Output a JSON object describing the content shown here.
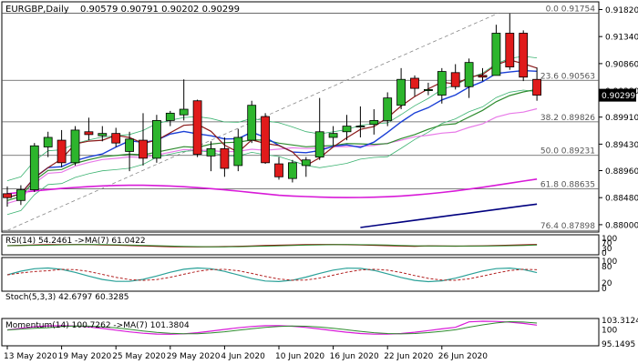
{
  "header": {
    "symbol": "EURGBP,Daily",
    "ohlc": "0.90579 0.90791 0.90202 0.90299"
  },
  "colors": {
    "bull_candle": "#2db52d",
    "bear_candle": "#e01b1b",
    "ma_fast": "#8b1a1a",
    "ma_blue": "#1a3fd6",
    "ma_green": "#2e8b2e",
    "ma_pink": "#e87ae8",
    "ma_magenta": "#d81ad8",
    "ma_navy": "#00007f",
    "bollinger": "#3cb371",
    "fib": "#555555",
    "trend": "#888888",
    "price_tag": "#000000"
  },
  "chart_data": [
    {
      "type": "candlestick",
      "title": "EURGBP,Daily",
      "price_axis_ticks": [
        "0.91820",
        "0.91340",
        "0.90860",
        "0.90380",
        "0.89910",
        "0.89430",
        "0.88960",
        "0.88480",
        "0.88000"
      ],
      "ylim": [
        0.8795,
        0.9186
      ],
      "last_price": "0.90299",
      "date_labels": [
        "13 May 2020",
        "19 May 2020",
        "25 May 2020",
        "29 May 2020",
        "4 Jun 2020",
        "10 Jun 2020",
        "16 Jun 2020",
        "22 Jun 2020",
        "26 Jun 2020"
      ],
      "date_label_index": [
        0,
        4,
        8,
        12,
        16,
        20,
        24,
        28,
        32
      ],
      "fibonacci": [
        {
          "label": "0.0 0.91754",
          "value": 0.91754
        },
        {
          "label": "23.6 0.90563",
          "value": 0.90563
        },
        {
          "label": "38.2 0.89826",
          "value": 0.89826
        },
        {
          "label": "50.0 0.89231",
          "value": 0.89231
        },
        {
          "label": "61.8 0.88635",
          "value": 0.88635
        },
        {
          "label": "76.4 0.87898",
          "value": 0.87898
        }
      ],
      "candles": [
        {
          "o": 0.8855,
          "h": 0.8868,
          "l": 0.8832,
          "c": 0.8848
        },
        {
          "o": 0.8843,
          "h": 0.887,
          "l": 0.8835,
          "c": 0.8862
        },
        {
          "o": 0.8862,
          "h": 0.8945,
          "l": 0.8858,
          "c": 0.894
        },
        {
          "o": 0.8938,
          "h": 0.8965,
          "l": 0.892,
          "c": 0.8955
        },
        {
          "o": 0.895,
          "h": 0.8968,
          "l": 0.8902,
          "c": 0.891
        },
        {
          "o": 0.891,
          "h": 0.8975,
          "l": 0.8905,
          "c": 0.8968
        },
        {
          "o": 0.8965,
          "h": 0.899,
          "l": 0.895,
          "c": 0.896
        },
        {
          "o": 0.8958,
          "h": 0.8975,
          "l": 0.8948,
          "c": 0.8962
        },
        {
          "o": 0.8962,
          "h": 0.8972,
          "l": 0.8938,
          "c": 0.8945
        },
        {
          "o": 0.893,
          "h": 0.8965,
          "l": 0.8895,
          "c": 0.8952
        },
        {
          "o": 0.895,
          "h": 0.8998,
          "l": 0.8905,
          "c": 0.8918
        },
        {
          "o": 0.8918,
          "h": 0.8995,
          "l": 0.891,
          "c": 0.8985
        },
        {
          "o": 0.8985,
          "h": 0.9002,
          "l": 0.8975,
          "c": 0.8998
        },
        {
          "o": 0.8995,
          "h": 0.9058,
          "l": 0.8985,
          "c": 0.9005
        },
        {
          "o": 0.902,
          "h": 0.9022,
          "l": 0.892,
          "c": 0.8925
        },
        {
          "o": 0.8922,
          "h": 0.8948,
          "l": 0.8895,
          "c": 0.8935
        },
        {
          "o": 0.8935,
          "h": 0.8955,
          "l": 0.8885,
          "c": 0.89
        },
        {
          "o": 0.8905,
          "h": 0.897,
          "l": 0.8895,
          "c": 0.8955
        },
        {
          "o": 0.895,
          "h": 0.902,
          "l": 0.8945,
          "c": 0.9012
        },
        {
          "o": 0.8992,
          "h": 0.8998,
          "l": 0.8908,
          "c": 0.891
        },
        {
          "o": 0.8908,
          "h": 0.892,
          "l": 0.888,
          "c": 0.8885
        },
        {
          "o": 0.8882,
          "h": 0.8915,
          "l": 0.8875,
          "c": 0.891
        },
        {
          "o": 0.8905,
          "h": 0.892,
          "l": 0.8885,
          "c": 0.8915
        },
        {
          "o": 0.892,
          "h": 0.9025,
          "l": 0.8915,
          "c": 0.8965
        },
        {
          "o": 0.8955,
          "h": 0.8975,
          "l": 0.894,
          "c": 0.8962
        },
        {
          "o": 0.8965,
          "h": 0.8995,
          "l": 0.895,
          "c": 0.8975
        },
        {
          "o": 0.8975,
          "h": 0.901,
          "l": 0.8955,
          "c": 0.8975
        },
        {
          "o": 0.8978,
          "h": 0.9005,
          "l": 0.896,
          "c": 0.8985
        },
        {
          "o": 0.8985,
          "h": 0.9035,
          "l": 0.8975,
          "c": 0.9025
        },
        {
          "o": 0.9012,
          "h": 0.9078,
          "l": 0.9005,
          "c": 0.9058
        },
        {
          "o": 0.906,
          "h": 0.9065,
          "l": 0.9028,
          "c": 0.9042
        },
        {
          "o": 0.9038,
          "h": 0.9052,
          "l": 0.903,
          "c": 0.904
        },
        {
          "o": 0.903,
          "h": 0.9078,
          "l": 0.9015,
          "c": 0.9072
        },
        {
          "o": 0.907,
          "h": 0.9085,
          "l": 0.904,
          "c": 0.9045
        },
        {
          "o": 0.9045,
          "h": 0.9095,
          "l": 0.9025,
          "c": 0.9088
        },
        {
          "o": 0.9065,
          "h": 0.9078,
          "l": 0.9055,
          "c": 0.9062
        },
        {
          "o": 0.9065,
          "h": 0.9155,
          "l": 0.9065,
          "c": 0.914
        },
        {
          "o": 0.914,
          "h": 0.9175,
          "l": 0.9075,
          "c": 0.908
        },
        {
          "o": 0.914,
          "h": 0.9145,
          "l": 0.9055,
          "c": 0.9062
        },
        {
          "o": 0.9058,
          "h": 0.9079,
          "l": 0.902,
          "c": 0.903
        }
      ]
    },
    {
      "type": "line",
      "title": "RSI(14) 54.2461 ->MA(7) 61.0422",
      "axis_ticks": [
        "100",
        "70",
        "30",
        "0"
      ],
      "ylim": [
        0,
        100
      ]
    },
    {
      "type": "line",
      "title": "Stoch(5,3,3) 42.6797 60.3285",
      "axis_ticks": [
        "100",
        "80",
        "20",
        "0"
      ],
      "ylim": [
        0,
        100
      ]
    },
    {
      "type": "line",
      "title": "Momentum(14) 100.7262 ->MA(7) 101.3804",
      "axis_ticks": [
        "103.3124",
        "100",
        "95.1495"
      ],
      "ylim": [
        95.1495,
        103.3124
      ]
    }
  ]
}
